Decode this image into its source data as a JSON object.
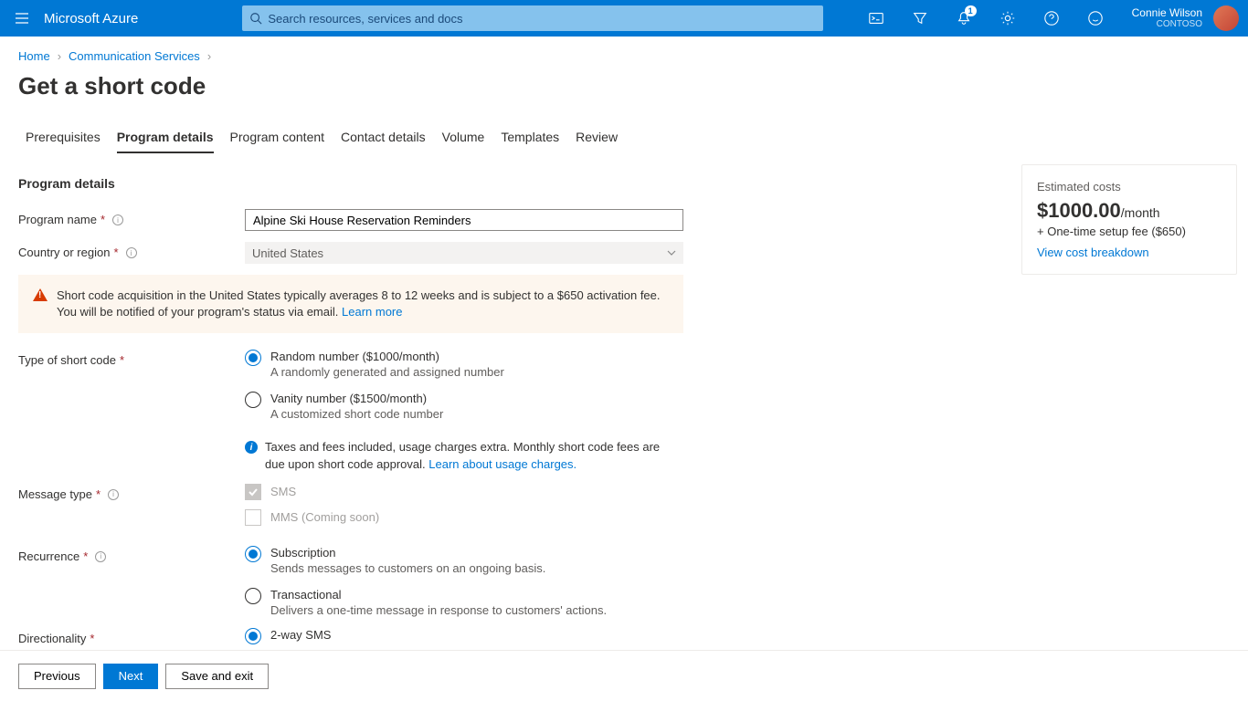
{
  "brand": "Microsoft Azure",
  "search": {
    "placeholder": "Search resources, services and docs"
  },
  "notifications": {
    "count": "1"
  },
  "user": {
    "name": "Connie Wilson",
    "org": "CONTOSO"
  },
  "breadcrumb": {
    "home": "Home",
    "cs": "Communication Services"
  },
  "page_title": "Get a short code",
  "tabs": [
    "Prerequisites",
    "Program details",
    "Program content",
    "Contact details",
    "Volume",
    "Templates",
    "Review"
  ],
  "section_title": "Program details",
  "labels": {
    "program_name": "Program name",
    "country": "Country or region",
    "type_short_code": "Type of short code",
    "message_type": "Message type",
    "recurrence": "Recurrence",
    "directionality": "Directionality"
  },
  "program_name_value": "Alpine Ski House Reservation Reminders",
  "country_value": "United States",
  "warning": {
    "text": "Short code acquisition in the United States typically averages 8 to 12 weeks and is subject to a $650 activation fee. You will be notified of your program's status via email. ",
    "link": "Learn more"
  },
  "type_options": {
    "random": {
      "title": "Random number ($1000/month)",
      "desc": "A randomly generated and assigned number"
    },
    "vanity": {
      "title": "Vanity number ($1500/month)",
      "desc": "A customized short code number"
    }
  },
  "tax_note": {
    "text": "Taxes and fees included, usage charges extra. Monthly short code fees are due upon short code approval. ",
    "link": "Learn about usage charges."
  },
  "msg_type": {
    "sms": "SMS",
    "mms": "MMS (Coming soon)"
  },
  "recurrence": {
    "sub": {
      "title": "Subscription",
      "desc": "Sends messages to customers on an ongoing basis."
    },
    "trans": {
      "title": "Transactional",
      "desc": "Delivers a one-time message in response to customers' actions."
    }
  },
  "directionality": {
    "two_way": "2-way SMS"
  },
  "cost": {
    "label": "Estimated costs",
    "amount": "$1000.00",
    "per": "/month",
    "sub": "+ One-time setup fee ($650)",
    "link": "View cost breakdown"
  },
  "footer": {
    "prev": "Previous",
    "next": "Next",
    "save": "Save and exit"
  }
}
